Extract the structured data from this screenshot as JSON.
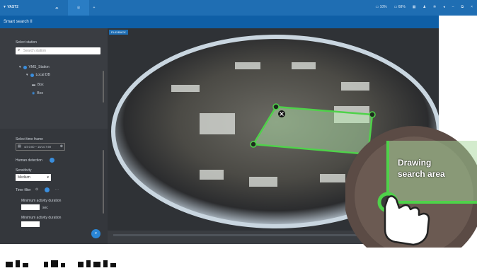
{
  "topbar": {
    "app_name": "VAST2",
    "add_tab": "+",
    "indicator1_value": "10%",
    "indicator2_value": "68%",
    "menu_icons": [
      "grid-icon",
      "bell-icon",
      "gear-icon",
      "speaker-icon"
    ],
    "window_controls": [
      "minimize-icon",
      "restore-icon",
      "close-icon"
    ]
  },
  "titlebar": {
    "title": "Smart search II"
  },
  "sidebar": {
    "select_station_label": "Select station",
    "search_placeholder": "Search station",
    "tree": {
      "station": "VMS_Station",
      "db": "Local DB",
      "camera1": "Box",
      "camera2": "Box"
    },
    "time_frame_label": "Select time frame",
    "time_frame_value": "4/3 0:00 ~ 10/14 7:59",
    "human_detection_label": "Human detection",
    "sensitivity_label": "Sensitivity",
    "sensitivity_value": "Medium",
    "time_filter_label": "Time filter",
    "min_activity_label": "Minimum activity duration",
    "min_activity_unit": "sec",
    "min_activity2_label": "Minimum activity duration"
  },
  "viewer": {
    "playback_badge": "PLAYBACK"
  },
  "callout": {
    "line1": "Drawing",
    "line2": "search area"
  },
  "colors": {
    "accent": "#1f6eb3",
    "selection": "#4fd24a",
    "sidebar_bg": "#3a3d42"
  }
}
